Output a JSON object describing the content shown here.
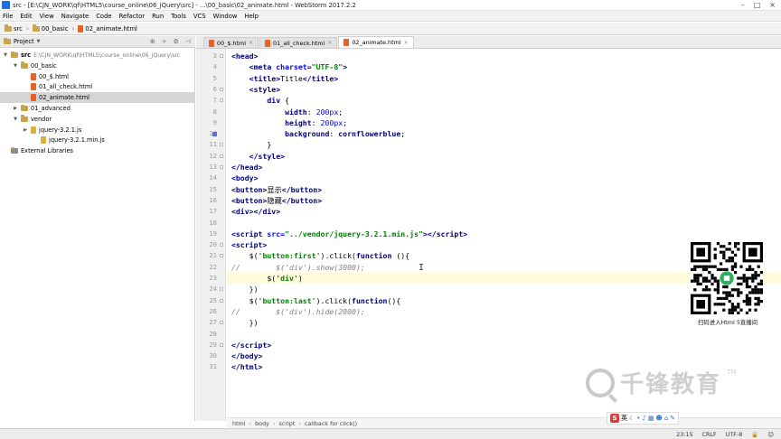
{
  "window": {
    "title": "src - [E:\\CJN_WORK\\qf\\HTML5\\course_online\\06_jQuery\\src] - ...\\00_basic\\02_animate.html - WebStorm 2017.2.2"
  },
  "menu": [
    "File",
    "Edit",
    "View",
    "Navigate",
    "Code",
    "Refactor",
    "Run",
    "Tools",
    "VCS",
    "Window",
    "Help"
  ],
  "breadcrumb": [
    "src",
    "00_basic",
    "02_animate.html"
  ],
  "project": {
    "header": "Project",
    "tree": [
      {
        "label": "src",
        "path": "E:\\CJN_WORK\\qf\\HTML5\\course_online\\06_jQuery\\src",
        "type": "folder",
        "level": 0,
        "expanded": true
      },
      {
        "label": "00_basic",
        "type": "folder",
        "level": 1,
        "expanded": true
      },
      {
        "label": "00_$.html",
        "type": "html",
        "level": 2
      },
      {
        "label": "01_all_check.html",
        "type": "html",
        "level": 2
      },
      {
        "label": "02_animate.html",
        "type": "html",
        "level": 2,
        "selected": true
      },
      {
        "label": "01_advanced",
        "type": "folder",
        "level": 1
      },
      {
        "label": "vendor",
        "type": "folder",
        "level": 1,
        "expanded": true
      },
      {
        "label": "jquery-3.2.1.js",
        "type": "js",
        "level": 2,
        "expandable": true
      },
      {
        "label": "jquery-3.2.1.min.js",
        "type": "js",
        "level": 3
      },
      {
        "label": "External Libraries",
        "type": "lib",
        "level": 0
      }
    ]
  },
  "tabs": [
    {
      "label": "00_$.html",
      "active": false
    },
    {
      "label": "01_all_check.html",
      "active": false
    },
    {
      "label": "02_animate.html",
      "active": true
    }
  ],
  "code_lines": [
    {
      "n": 3,
      "html": "<span class=\"tag\">&lt;head&gt;</span>"
    },
    {
      "n": 4,
      "html": "    <span class=\"tag\">&lt;meta </span><span class=\"attr\">charset=</span><span class=\"str\">\"UTF-8\"</span><span class=\"tag\">&gt;</span>"
    },
    {
      "n": 5,
      "html": "    <span class=\"tag\">&lt;title&gt;</span>Title<span class=\"tag\">&lt;/title&gt;</span>"
    },
    {
      "n": 6,
      "html": "    <span class=\"tag\">&lt;style&gt;</span>"
    },
    {
      "n": 7,
      "html": "        <span class=\"css\">div</span> {"
    },
    {
      "n": 8,
      "html": "            <span class=\"css\">width</span>: <span class=\"num\">200px</span>;"
    },
    {
      "n": 9,
      "html": "            <span class=\"css\">height</span>: <span class=\"num\">200px</span>;"
    },
    {
      "n": 10,
      "html": "            <span class=\"css\">background</span>: <span class=\"css\">cornflowerblue</span>;"
    },
    {
      "n": 11,
      "html": "        }"
    },
    {
      "n": 12,
      "html": "    <span class=\"tag\">&lt;/style&gt;</span>"
    },
    {
      "n": 13,
      "html": "<span class=\"tag\">&lt;/head&gt;</span>"
    },
    {
      "n": 14,
      "html": "<span class=\"tag\">&lt;body&gt;</span>"
    },
    {
      "n": 15,
      "html": "<span class=\"tag\">&lt;button&gt;</span>显示<span class=\"tag\">&lt;/button&gt;</span>"
    },
    {
      "n": 16,
      "html": "<span class=\"tag\">&lt;button&gt;</span>隐藏<span class=\"tag\">&lt;/button&gt;</span>"
    },
    {
      "n": 17,
      "html": "<span class=\"tag\">&lt;div&gt;&lt;/div&gt;</span>"
    },
    {
      "n": 18,
      "html": ""
    },
    {
      "n": 19,
      "html": "<span class=\"tag\">&lt;script </span><span class=\"attr\">src=</span><span class=\"str\">\"../vendor/jquery-3.2.1.min.js\"</span><span class=\"tag\">&gt;&lt;/script&gt;</span>"
    },
    {
      "n": 20,
      "html": "<span class=\"tag\">&lt;script&gt;</span>"
    },
    {
      "n": 21,
      "html": "    $(<span class=\"str\">'button:first'</span>).click(<span class=\"kw\">function</span> (){"
    },
    {
      "n": 22,
      "html": "<span class=\"cmt\">//        $('div').show(3000);</span>"
    },
    {
      "n": 23,
      "html": "        $(<span class=\"str\">'div'</span>)",
      "current": true
    },
    {
      "n": 24,
      "html": "    })"
    },
    {
      "n": 25,
      "html": "    $(<span class=\"str\">'button:last'</span>).click(<span class=\"kw\">function</span>(){"
    },
    {
      "n": 26,
      "html": "<span class=\"cmt\">//        $('div').hide(2000);</span>"
    },
    {
      "n": 27,
      "html": "    })"
    },
    {
      "n": 28,
      "html": ""
    },
    {
      "n": 29,
      "html": "<span class=\"tag\">&lt;/script&gt;</span>"
    },
    {
      "n": 30,
      "html": "<span class=\"tag\">&lt;/body&gt;</span>"
    },
    {
      "n": 31,
      "html": "<span class=\"tag\">&lt;/html&gt;</span>"
    }
  ],
  "editor_breadcrumb": [
    "html",
    "body",
    "script",
    "callback for click()"
  ],
  "status": {
    "position": "23:15",
    "line_sep": "CRLF",
    "encoding": "UTF-8"
  },
  "overlay": {
    "qr_caption": "扫码进入Html 5直播间",
    "watermark": "千锋教育",
    "watermark_tm": "TM",
    "ime_label": "英"
  },
  "colors": {
    "accent": "#1e6fd9",
    "tag": "#000080",
    "string": "#008000",
    "comment": "#808080",
    "current_line": "#fdfbd8"
  }
}
